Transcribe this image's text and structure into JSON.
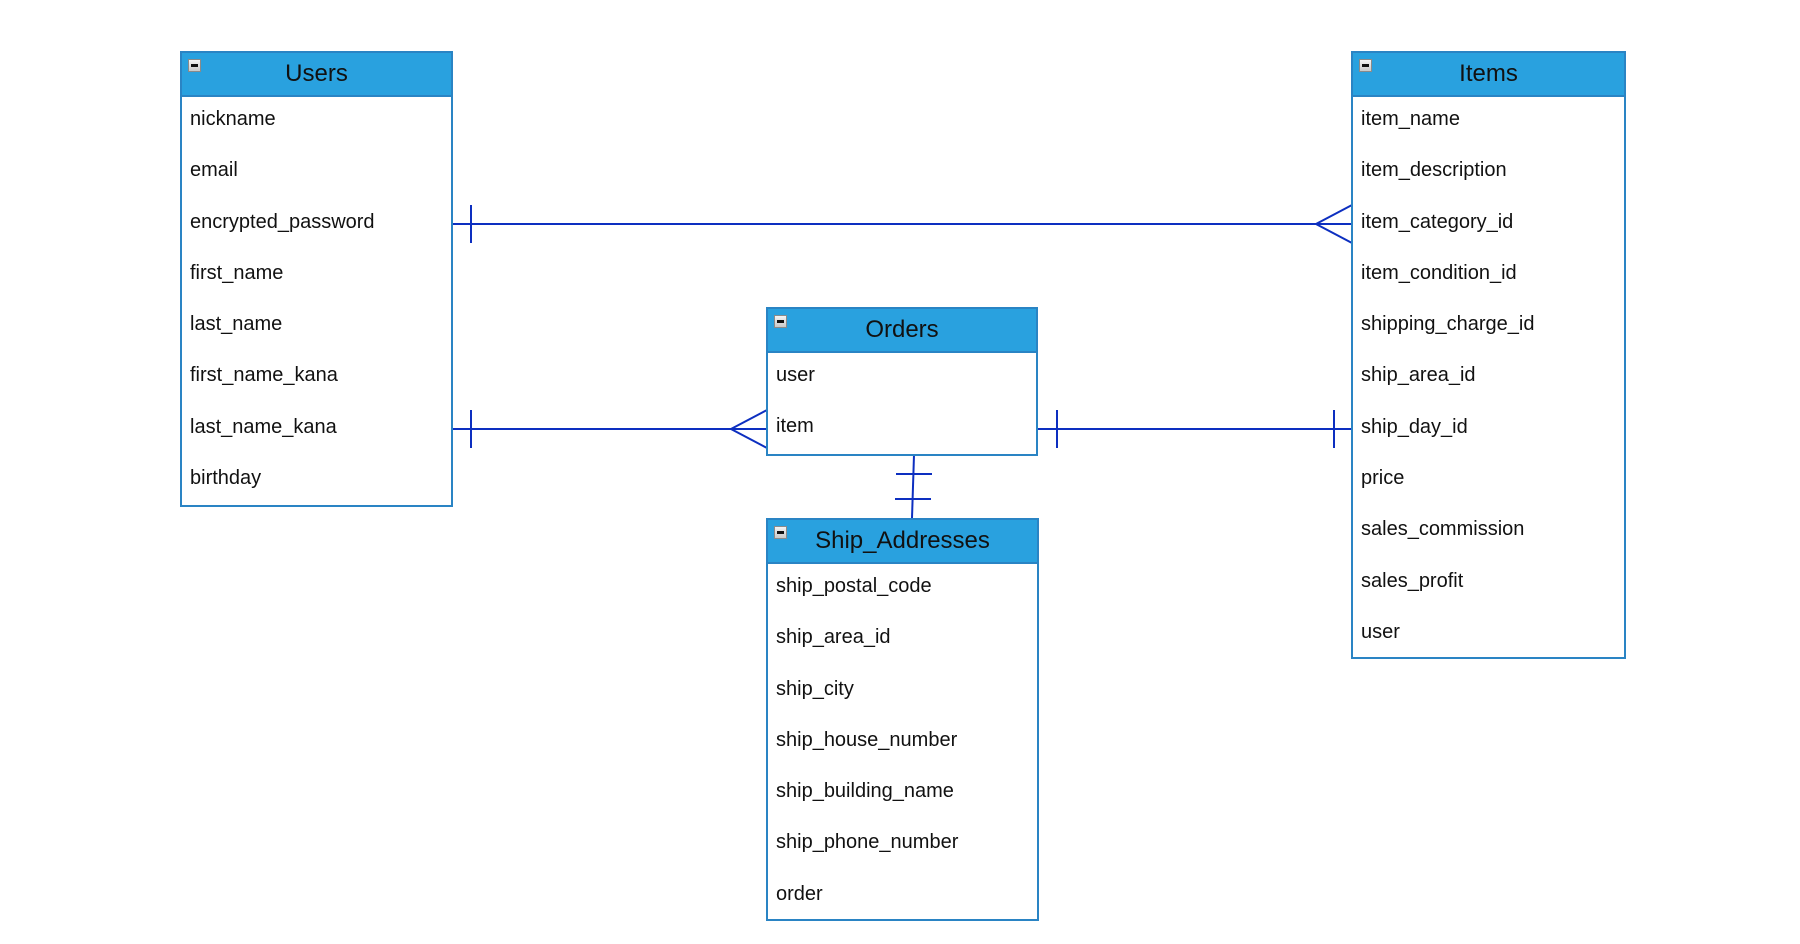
{
  "diagram": {
    "type": "entity-relationship",
    "colors": {
      "header_fill": "#29a1df",
      "border": "#2a84c4",
      "connector": "#0d2fc0"
    },
    "entities": {
      "users": {
        "title": "Users",
        "fields": [
          "nickname",
          "email",
          "encrypted_password",
          "first_name",
          "last_name",
          "first_name_kana",
          "last_name_kana",
          "birthday"
        ]
      },
      "items": {
        "title": "Items",
        "fields": [
          "item_name",
          "item_description",
          "item_category_id",
          "item_condition_id",
          "shipping_charge_id",
          "ship_area_id",
          "ship_day_id",
          "price",
          "sales_commission",
          "sales_profit",
          "user"
        ]
      },
      "orders": {
        "title": "Orders",
        "fields": [
          "user",
          "item"
        ]
      },
      "ship_addresses": {
        "title": "Ship_Addresses",
        "fields": [
          "ship_postal_code",
          "ship_area_id",
          "ship_city",
          "ship_house_number",
          "ship_building_name",
          "ship_phone_number",
          "order"
        ]
      }
    },
    "relationships": [
      {
        "from": "Users",
        "to": "Items",
        "from_cardinality": "one",
        "to_cardinality": "many"
      },
      {
        "from": "Users",
        "to": "Orders",
        "from_cardinality": "one",
        "to_cardinality": "many"
      },
      {
        "from": "Orders",
        "to": "Items",
        "from_cardinality": "one",
        "to_cardinality": "one"
      },
      {
        "from": "Orders",
        "to": "Ship_Addresses",
        "from_cardinality": "one-and-only-one",
        "to_cardinality": "one-and-only-one"
      }
    ]
  }
}
